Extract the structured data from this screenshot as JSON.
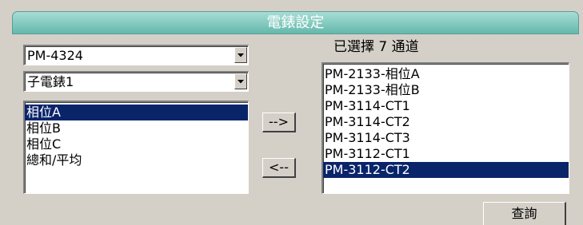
{
  "window": {
    "title": "電錶設定"
  },
  "meter_select": {
    "value": "PM-4324"
  },
  "submeter_select": {
    "value": "子電錶1"
  },
  "phase_list": {
    "items": [
      {
        "label": "相位A",
        "selected": true
      },
      {
        "label": "相位B",
        "selected": false
      },
      {
        "label": "相位C",
        "selected": false
      },
      {
        "label": "總和/平均",
        "selected": false
      }
    ]
  },
  "buttons": {
    "add_label": "-->",
    "remove_label": "<--",
    "query_label": "查詢"
  },
  "selected_channels": {
    "header": "已選擇 7 通道",
    "items": [
      {
        "label": "PM-2133-相位A",
        "selected": false
      },
      {
        "label": "PM-2133-相位B",
        "selected": false
      },
      {
        "label": "PM-3114-CT1",
        "selected": false
      },
      {
        "label": "PM-3114-CT2",
        "selected": false
      },
      {
        "label": "PM-3114-CT3",
        "selected": false
      },
      {
        "label": "PM-3112-CT1",
        "selected": false
      },
      {
        "label": "PM-3112-CT2",
        "selected": true
      }
    ]
  },
  "colors": {
    "title_bar": "#64b8ac",
    "selection": "#0a246a",
    "background": "#d4d0c8"
  }
}
